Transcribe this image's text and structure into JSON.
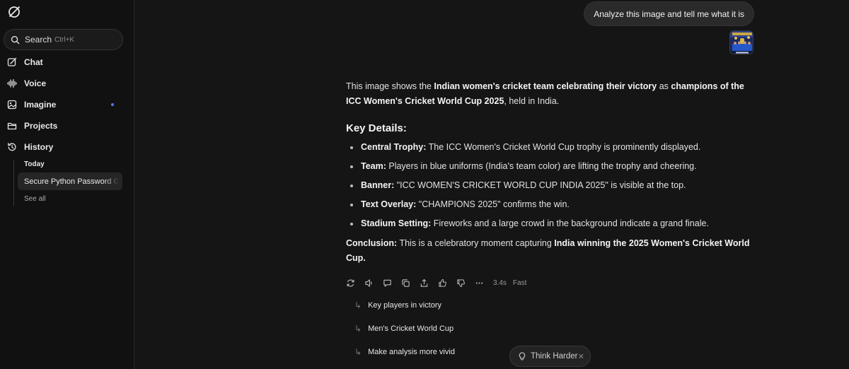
{
  "sidebar": {
    "search": {
      "label": "Search",
      "shortcut": "Ctrl+K"
    },
    "nav": [
      {
        "label": "Chat",
        "icon": "chat-edit-icon"
      },
      {
        "label": "Voice",
        "icon": "voice-wave-icon"
      },
      {
        "label": "Imagine",
        "icon": "image-icon"
      },
      {
        "label": "Projects",
        "icon": "folder-icon"
      },
      {
        "label": "History",
        "icon": "history-icon"
      }
    ],
    "history": {
      "section": "Today",
      "items": [
        "Secure Python Password Generator"
      ],
      "see_all": "See all"
    },
    "colors": {
      "indicator": "#5a78e6"
    }
  },
  "chat": {
    "user_message": "Analyze this image and tell me what it is",
    "answer": {
      "intro_a": "This image shows the ",
      "intro_b": "Indian women's cricket team celebrating their victory",
      "intro_c": " as ",
      "intro_d": "champions of the ICC Women's Cricket World Cup 2025",
      "intro_e": ", held in India.",
      "heading": "Key Details:",
      "details": [
        {
          "term": "Central Trophy:",
          "text": " The ICC Women's Cricket World Cup trophy is prominently displayed."
        },
        {
          "term": "Team:",
          "text": " Players in blue uniforms (India's team color) are lifting the trophy and cheering."
        },
        {
          "term": "Banner:",
          "text": " \"ICC WOMEN'S CRICKET WORLD CUP INDIA 2025\" is visible at the top."
        },
        {
          "term": "Text Overlay:",
          "text": " \"CHAMPIONS 2025\" confirms the win."
        },
        {
          "term": "Stadium Setting:",
          "text": " Fireworks and a large crowd in the background indicate a grand finale."
        }
      ],
      "conclusion_term": "Conclusion:",
      "conclusion_a": " This is a celebratory moment capturing ",
      "conclusion_b": "India winning the 2025 Women's Cricket World Cup."
    },
    "meta": {
      "time": "3.4s",
      "mode": "Fast"
    },
    "suggestions": [
      "Key players in victory",
      "Men's Cricket World Cup",
      "Make analysis more vivid"
    ],
    "think_harder": "Think Harder"
  }
}
